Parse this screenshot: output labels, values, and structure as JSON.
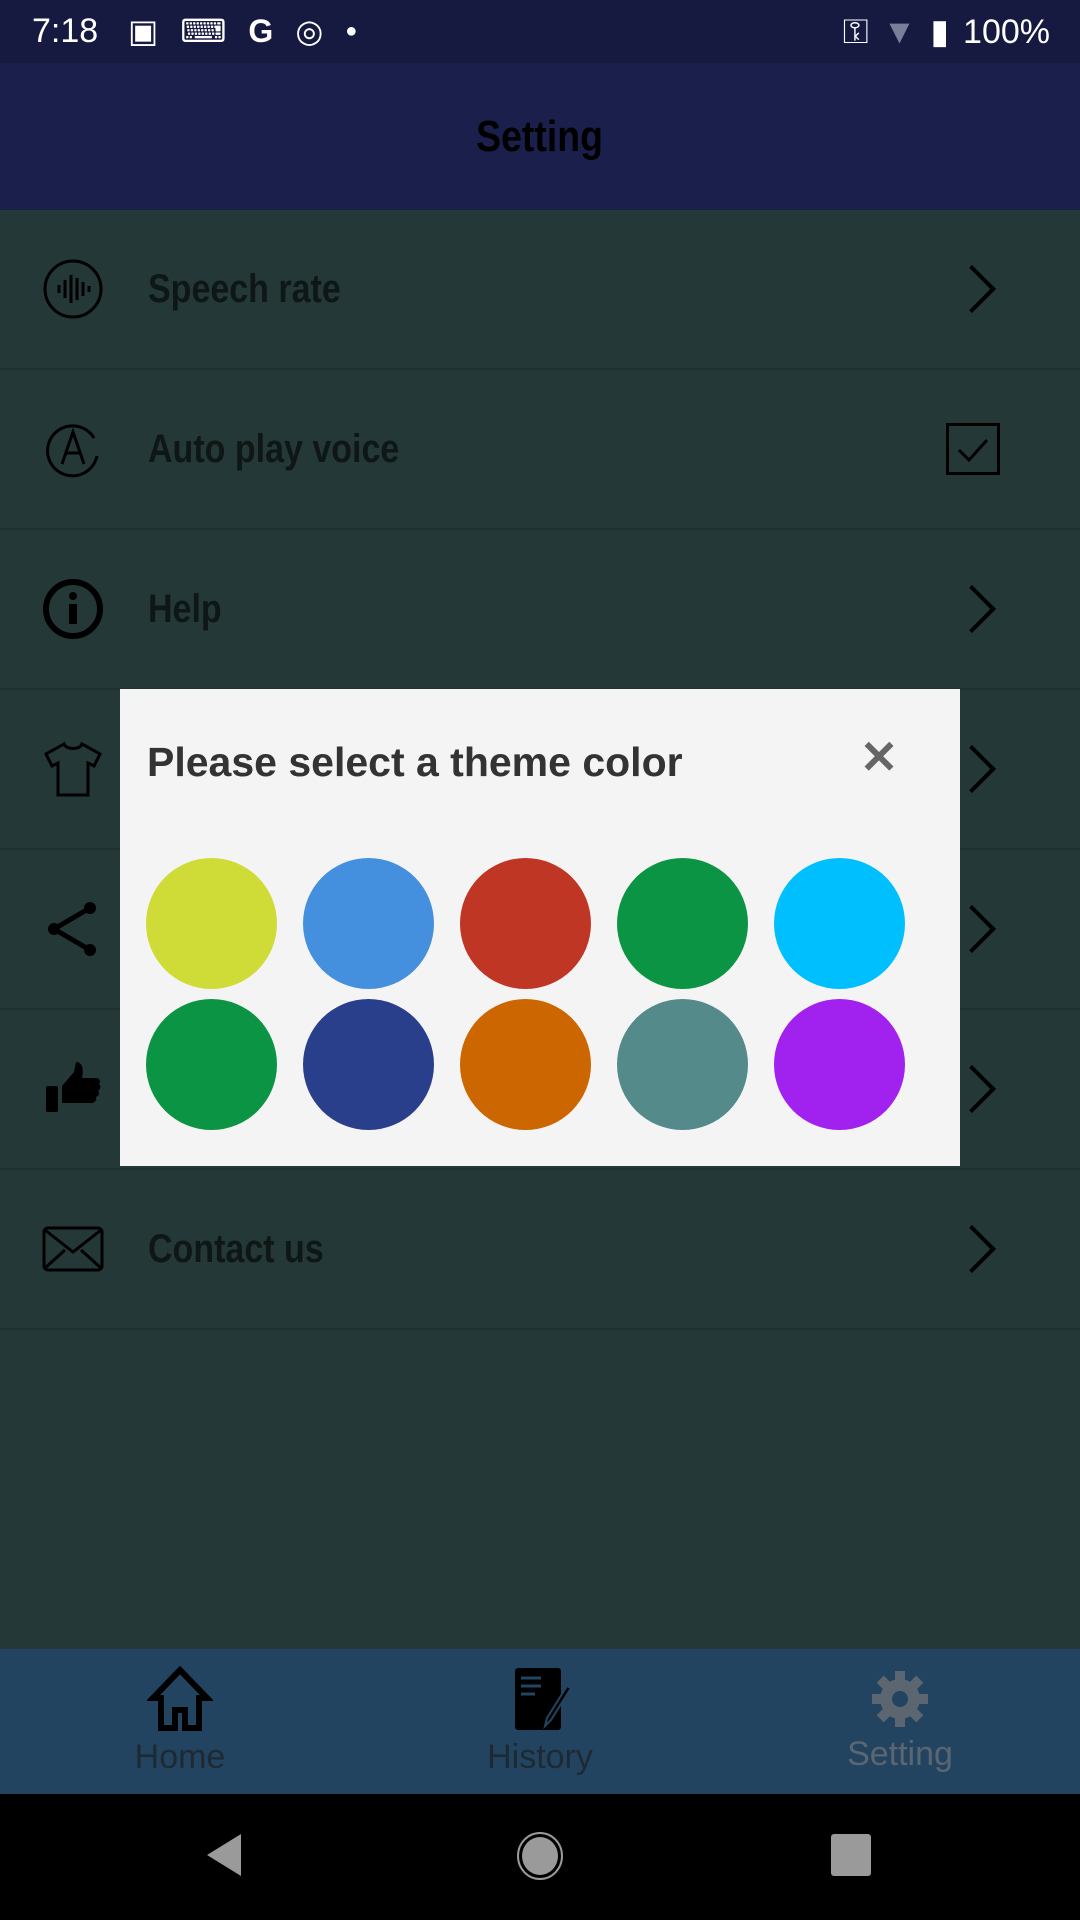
{
  "status_bar": {
    "time": "7:18",
    "battery": "100%"
  },
  "app_bar": {
    "title": "Setting"
  },
  "settings": [
    {
      "label": "Speech rate",
      "icon": "voice-wave-icon",
      "control": "chevron"
    },
    {
      "label": "Auto play voice",
      "icon": "auto-play-icon",
      "control": "checkbox",
      "checked": true
    },
    {
      "label": "Help",
      "icon": "info-icon",
      "control": "chevron"
    },
    {
      "label": "",
      "icon": "tshirt-icon",
      "control": "chevron"
    },
    {
      "label": "",
      "icon": "share-icon",
      "control": "chevron"
    },
    {
      "label": "",
      "icon": "thumbs-up-icon",
      "control": "chevron"
    },
    {
      "label": "Contact us",
      "icon": "mail-icon",
      "control": "chevron"
    }
  ],
  "dialog": {
    "title": "Please select a theme color",
    "close": "✕",
    "colors": [
      "#cfdb37",
      "#4590de",
      "#c03624",
      "#0b9443",
      "#00bfff",
      "#0b9443",
      "#293f8c",
      "#cc6600",
      "#558a8a",
      "#a121ee"
    ]
  },
  "bottom_nav": [
    {
      "label": "Home",
      "icon": "home-icon"
    },
    {
      "label": "History",
      "icon": "history-icon"
    },
    {
      "label": "Setting",
      "icon": "gear-icon",
      "active": true
    }
  ]
}
